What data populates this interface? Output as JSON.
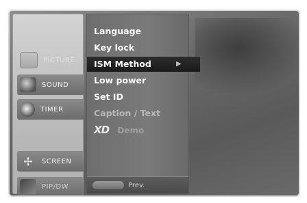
{
  "main_menu": {
    "items": [
      {
        "label": "PICTURE",
        "icon": "picture-icon"
      },
      {
        "label": "SOUND",
        "icon": "speaker-icon"
      },
      {
        "label": "TIMER",
        "icon": "clock-icon"
      },
      {
        "label": "SCREEN",
        "icon": "screen-adjust-icon"
      },
      {
        "label": "PIP/DW",
        "icon": "pip-icon"
      }
    ]
  },
  "special_menu": {
    "items": [
      {
        "label": "Language"
      },
      {
        "label": "Key lock"
      },
      {
        "label": "ISM Method",
        "arrow": "▶"
      },
      {
        "label": "Low power"
      },
      {
        "label": "Set ID"
      },
      {
        "label": "Caption / Text"
      },
      {
        "logo": "XD",
        "label": "Demo"
      }
    ],
    "selected": "ISM Method"
  },
  "footer": {
    "prev_label": "Prev."
  }
}
